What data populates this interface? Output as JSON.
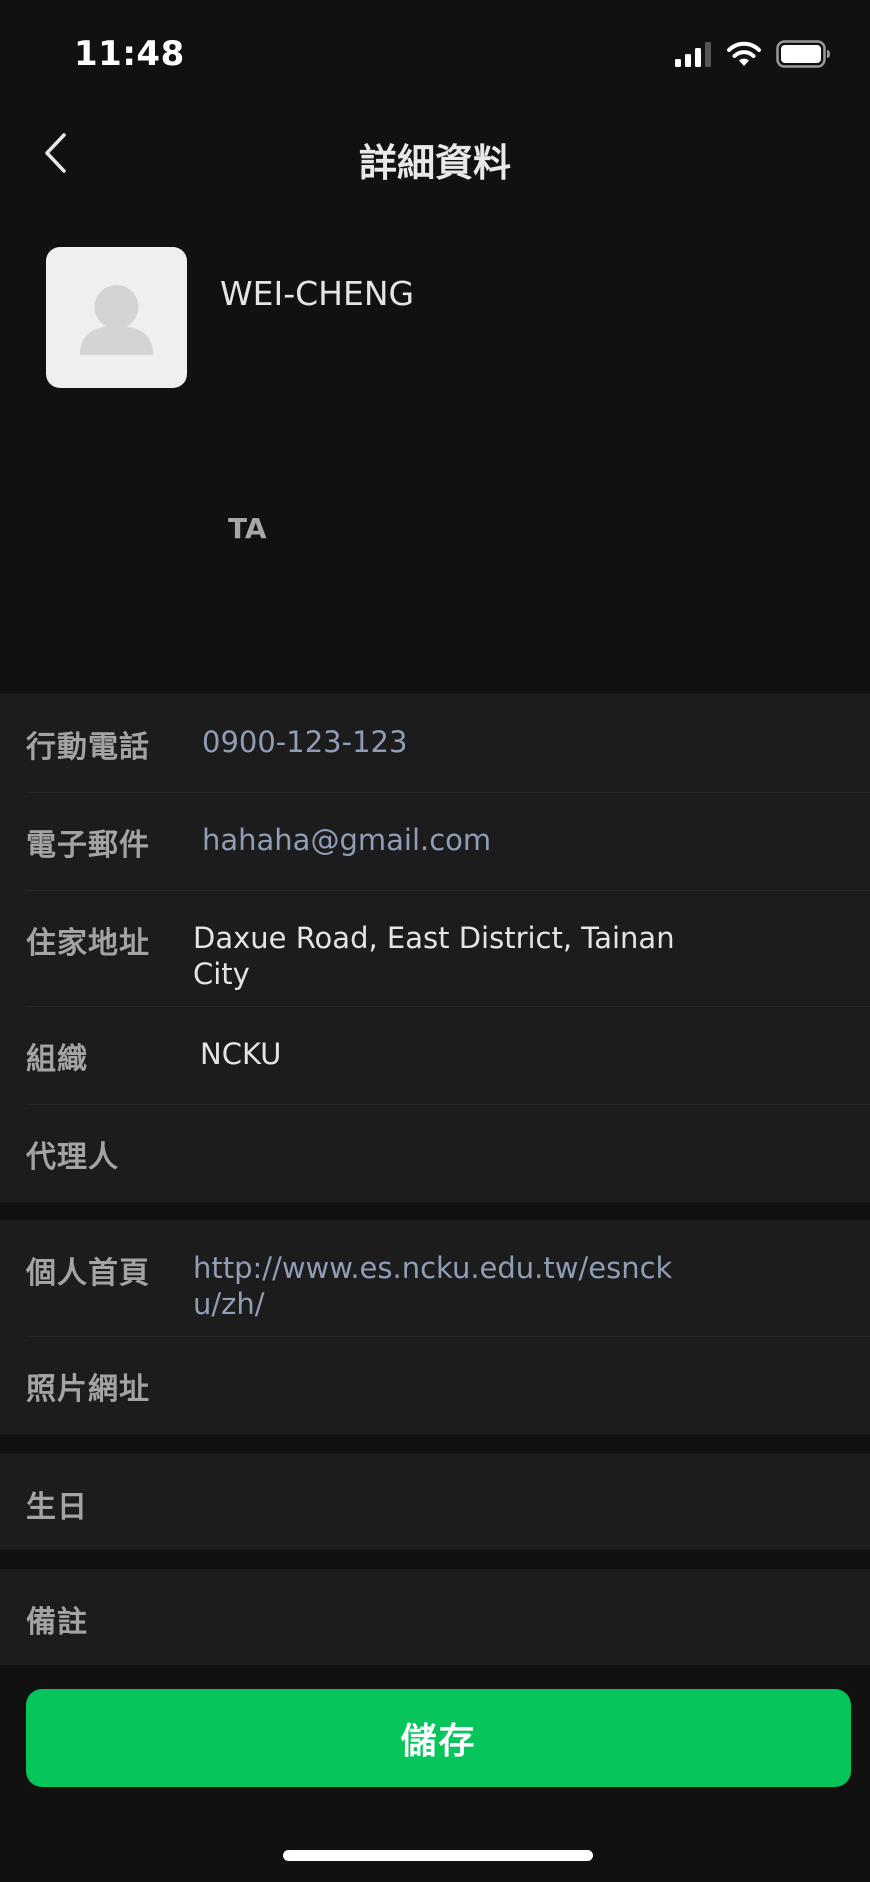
{
  "status_bar": {
    "time": "11:48"
  },
  "nav": {
    "title": "詳細資料"
  },
  "profile": {
    "name": "WEI-CHENG",
    "tag": "TA"
  },
  "fields": {
    "mobile": {
      "label": "行動電話",
      "value": "0900-123-123"
    },
    "email": {
      "label": "電子郵件",
      "value": "hahaha@gmail.com"
    },
    "address": {
      "label": "住家地址",
      "line1": "Daxue Road, East District, Tainan",
      "line2": "City"
    },
    "organization": {
      "label": "組織",
      "value": "NCKU"
    },
    "agent": {
      "label": "代理人",
      "value": ""
    },
    "homepage": {
      "label": "個人首頁",
      "line1": "http://www.es.ncku.edu.tw/esnck",
      "line2": "u/zh/"
    },
    "photo_url": {
      "label": "照片網址",
      "value": ""
    },
    "birthday": {
      "label": "生日",
      "value": ""
    },
    "notes": {
      "label": "備註",
      "value": ""
    }
  },
  "actions": {
    "save_label": "儲存"
  },
  "colors": {
    "background": "#111111",
    "section_background": "#1c1c1c",
    "accent_green": "#06c55a",
    "link_color": "#8f9db6"
  },
  "icons": [
    "cellular-signal-icon",
    "wifi-icon",
    "battery-icon",
    "back-chevron-icon",
    "default-avatar-icon"
  ]
}
